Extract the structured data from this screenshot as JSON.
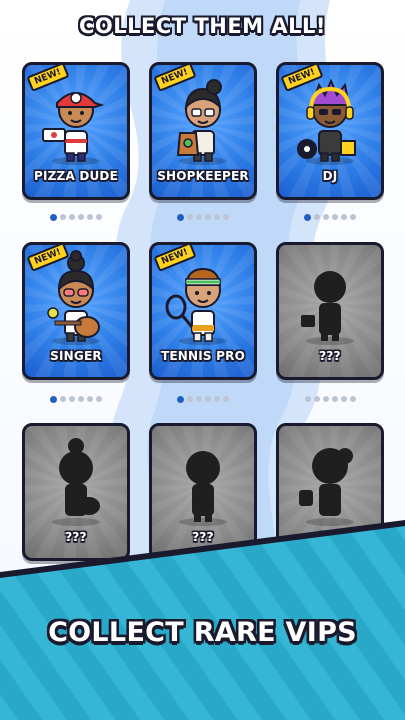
{
  "headline": "COLLECT THEM ALL!",
  "badge_text": "NEW!",
  "cards": [
    {
      "name": "PIZZA DUDE",
      "state": "unlocked",
      "is_new": true,
      "character_icon": "pizza-dude-character",
      "dots_total": 6,
      "dots_active": 1
    },
    {
      "name": "SHOPKEEPER",
      "state": "unlocked",
      "is_new": true,
      "character_icon": "shopkeeper-character",
      "dots_total": 6,
      "dots_active": 1
    },
    {
      "name": "DJ",
      "state": "unlocked",
      "is_new": true,
      "character_icon": "dj-character",
      "dots_total": 6,
      "dots_active": 1
    },
    {
      "name": "SINGER",
      "state": "unlocked",
      "is_new": true,
      "character_icon": "singer-character",
      "dots_total": 6,
      "dots_active": 1
    },
    {
      "name": "TENNIS PRO",
      "state": "unlocked",
      "is_new": true,
      "character_icon": "tennis-pro-character",
      "dots_total": 6,
      "dots_active": 1
    },
    {
      "name": "???",
      "state": "locked",
      "is_new": false,
      "character_icon": "silhouette-character",
      "dots_total": 6,
      "dots_active": 0
    },
    {
      "name": "???",
      "state": "locked",
      "is_new": false,
      "character_icon": "silhouette-character"
    },
    {
      "name": "???",
      "state": "locked",
      "is_new": false,
      "character_icon": "silhouette-character"
    },
    {
      "name": "???",
      "state": "locked",
      "is_new": false,
      "character_icon": "silhouette-character"
    }
  ],
  "banner_text": "COLLECT RARE VIPS",
  "colors": {
    "card_blue": "#2f7fe8",
    "card_locked": "#8a8a8a",
    "badge_yellow": "#ffd21f",
    "banner_teal": "#2aa8c8",
    "outline": "#1a1a2e"
  }
}
